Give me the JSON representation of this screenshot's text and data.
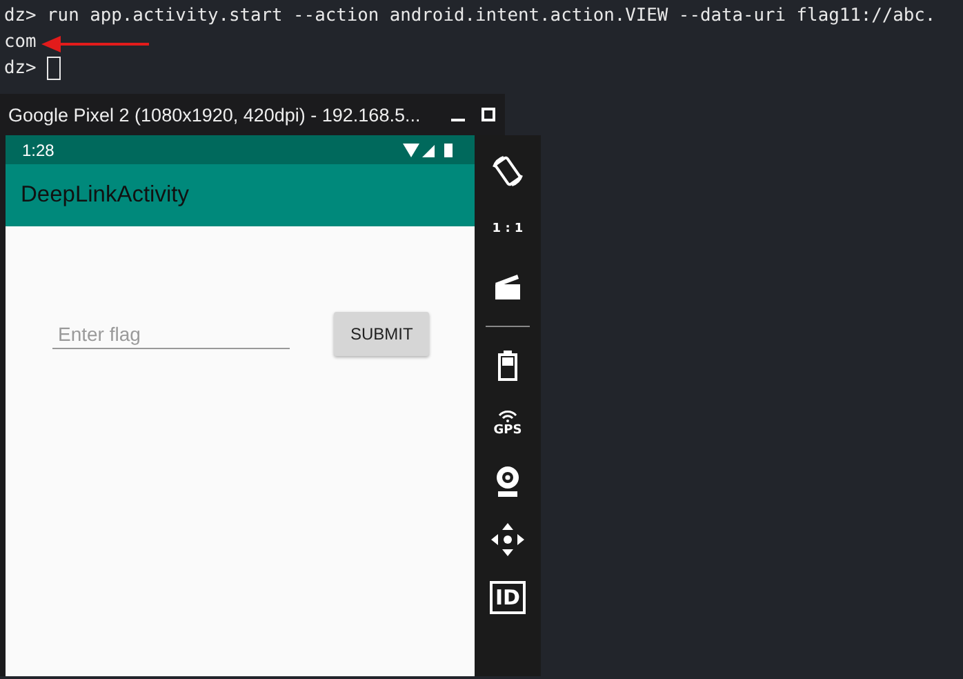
{
  "terminal": {
    "lines": [
      {
        "kind": "output",
        "text": "dz> run app.activity.start --action android.intent.action.VIEW --data-uri flag11://abc."
      },
      {
        "kind": "output",
        "text": "com"
      },
      {
        "kind": "prompt",
        "text": "dz>"
      }
    ]
  },
  "emulator": {
    "title": "Google Pixel 2 (1080x1920, 420dpi) - 192.168.5...",
    "status_bar": {
      "time": "1:28"
    },
    "app_bar": {
      "title": "DeepLinkActivity"
    },
    "flag_field": {
      "placeholder": "Enter flag"
    },
    "submit_button": {
      "label": "SUBMIT"
    },
    "toolbar": [
      {
        "kind": "rotate"
      },
      {
        "kind": "scale",
        "label": "1 : 1"
      },
      {
        "kind": "record"
      },
      {
        "kind": "divider"
      },
      {
        "kind": "battery"
      },
      {
        "kind": "gps",
        "label": "GPS"
      },
      {
        "kind": "camera"
      },
      {
        "kind": "dpad"
      },
      {
        "kind": "id",
        "label": "ID"
      }
    ]
  }
}
